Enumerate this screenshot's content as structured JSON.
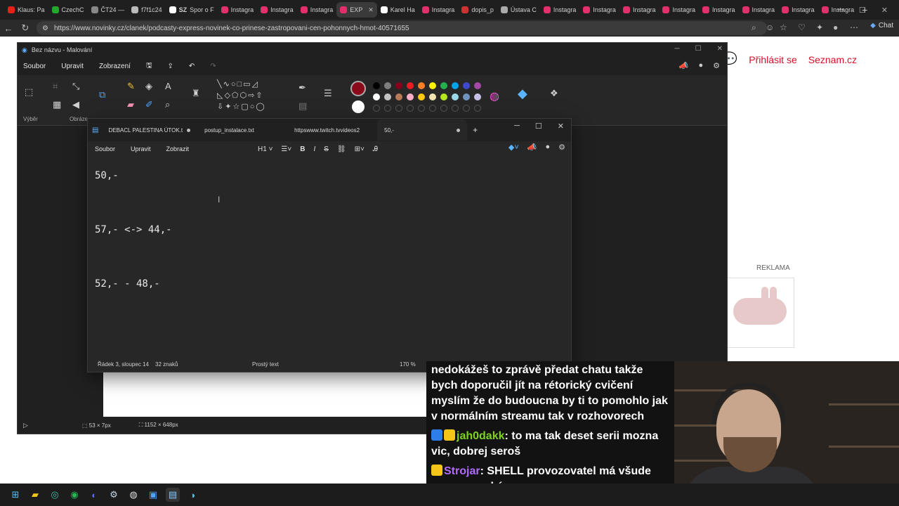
{
  "browser": {
    "tabs": [
      {
        "label": "Klaus: Pa",
        "color": "#e62117"
      },
      {
        "label": "CzechC",
        "color": "#1faa2b"
      },
      {
        "label": "ČT24 —",
        "color": "#888888"
      },
      {
        "label": "f7f1c24",
        "color": "#bbbbbb"
      },
      {
        "label": "Spor o F",
        "color": "#ffffff",
        "prefix": "SZ"
      },
      {
        "label": "Instagra",
        "color": "#e1306c"
      },
      {
        "label": "Instagra",
        "color": "#e1306c"
      },
      {
        "label": "Instagra",
        "color": "#e1306c"
      },
      {
        "label": "EXP",
        "color": "#e1306c",
        "active": true
      },
      {
        "label": "Karel Ha",
        "color": "#ffffff"
      },
      {
        "label": "Instagra",
        "color": "#e1306c"
      },
      {
        "label": "dopis_p",
        "color": "#cc3333"
      },
      {
        "label": "Ústava C",
        "color": "#aaaaaa"
      },
      {
        "label": "Instagra",
        "color": "#e1306c"
      },
      {
        "label": "Instagra",
        "color": "#e1306c"
      },
      {
        "label": "Instagra",
        "color": "#e1306c"
      },
      {
        "label": "Instagra",
        "color": "#e1306c"
      },
      {
        "label": "Instagra",
        "color": "#e1306c"
      },
      {
        "label": "Instagra",
        "color": "#e1306c"
      },
      {
        "label": "Instagra",
        "color": "#e1306c"
      },
      {
        "label": "Instagra",
        "color": "#e1306c"
      }
    ],
    "url": "https://www.novinky.cz/clanek/podcasty-express-novinek-co-prinese-zastropovani-cen-pohonnych-hmot-40571655",
    "chat_label": "Chat"
  },
  "webpage": {
    "login": "Přihlásit se",
    "seznam": "Seznam.cz",
    "ad_label": "REKLAMA"
  },
  "paint": {
    "title": "Bez názvu - Malování",
    "menu": [
      "Soubor",
      "Upravit",
      "Zobrazení"
    ],
    "labels": {
      "select": "Výběr",
      "image": "Obráze"
    },
    "status": {
      "selection": "53 × 7px",
      "canvas": "1152 × 648px"
    },
    "colors": {
      "primary": "#8b0a1a",
      "secondary": "#ffffff",
      "row1": [
        "#000000",
        "#7f7f7f",
        "#88001b",
        "#ec1c24",
        "#ff7f27",
        "#fff200",
        "#22b14c",
        "#00a2e8",
        "#3f48cc",
        "#a349a4"
      ],
      "row2": [
        "#ffffff",
        "#c3c3c3",
        "#b97a57",
        "#ffaec9",
        "#ffc90e",
        "#efe4b0",
        "#b5e61d",
        "#99d9ea",
        "#7092be",
        "#c8bfe7"
      ]
    }
  },
  "notepad": {
    "tabs": [
      {
        "label": "DEBACL PALESTINA ÚTOK.t",
        "dot": true
      },
      {
        "label": "postup_instalace.txt",
        "dot": false
      },
      {
        "label": "httpswww.twitch.tvvideos2",
        "dot": false
      },
      {
        "label": "50,-",
        "dot": true,
        "active": true
      }
    ],
    "menu": [
      "Soubor",
      "Upravit",
      "Zobrazit"
    ],
    "heading_btn": "H1",
    "content": "50,-\n\n57,- <-> 44,-\n\n52,- - 48,-",
    "status": {
      "position": "Řádek 3, sloupec 14",
      "chars": "32 znaků",
      "format": "Prostý text",
      "zoom": "170 %"
    }
  },
  "chat": {
    "messages": [
      {
        "user": "",
        "text": "nedokážeš to zprávě předat chatu takže bych doporučil jít na rétorický cvičení myslím že do budoucna by ti to pomohlo jak v normálním streamu tak v rozhovorech"
      },
      {
        "user": "jah0dakk",
        "sep": ":",
        "text": " to ma tak deset serii mozna vic, dobrej seroš"
      },
      {
        "user": "Strojar",
        "sep": ":",
        "text": " SHELL provozovatel má všude ceny rovnaké."
      }
    ]
  }
}
